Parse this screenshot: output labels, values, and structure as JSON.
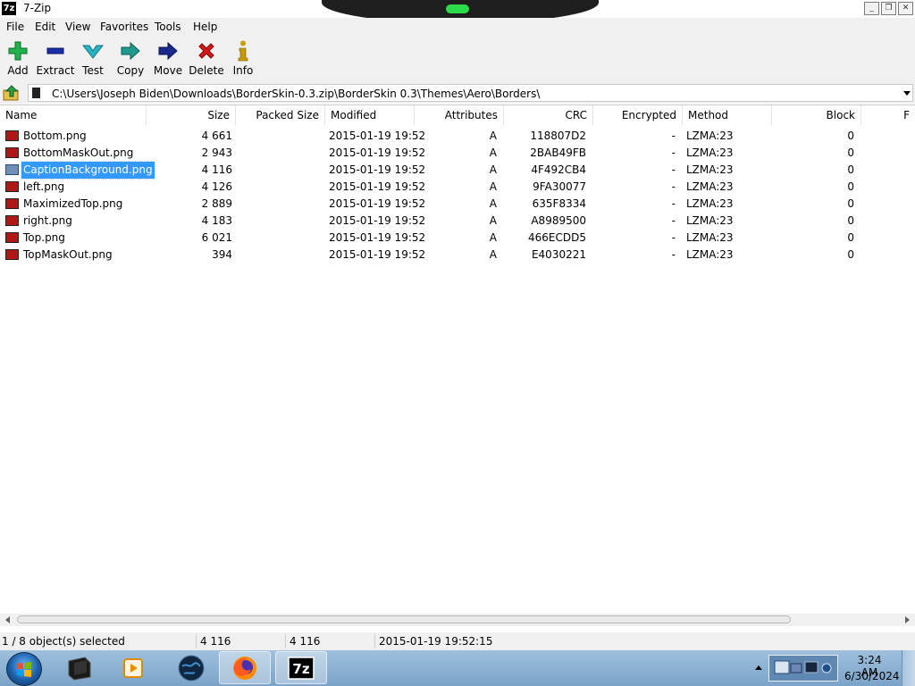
{
  "window": {
    "title": "7-Zip",
    "app_icon": "7z"
  },
  "menu": [
    "File",
    "Edit",
    "View",
    "Favorites",
    "Tools",
    "Help"
  ],
  "toolbar": [
    {
      "label": "Add",
      "icon": "plus-icon",
      "color": "#22b14c"
    },
    {
      "label": "Extract",
      "icon": "minus-icon",
      "color": "#1a2fa8"
    },
    {
      "label": "Test",
      "icon": "check-chevron-icon",
      "color": "#27b6c4"
    },
    {
      "label": "Copy",
      "icon": "arrow-right-icon",
      "color": "#1d9a8c"
    },
    {
      "label": "Move",
      "icon": "arrow-right-icon",
      "color": "#1a2a8c"
    },
    {
      "label": "Delete",
      "icon": "x-icon",
      "color": "#d61818"
    },
    {
      "label": "Info",
      "icon": "info-icon",
      "color": "#c89b00"
    }
  ],
  "address": {
    "path": "C:\\Users\\Joseph Biden\\Downloads\\BorderSkin-0.3.zip\\BorderSkin 0.3\\Themes\\Aero\\Borders\\"
  },
  "columns": [
    "Name",
    "Size",
    "Packed Size",
    "Modified",
    "Attributes",
    "CRC",
    "Encrypted",
    "Method",
    "Block",
    "F"
  ],
  "files": [
    {
      "name": "Bottom.png",
      "size": "4 661",
      "packed": "",
      "modified": "2015-01-19 19:52",
      "attr": "A",
      "crc": "118807D2",
      "enc": "-",
      "method": "LZMA:23",
      "block": "0"
    },
    {
      "name": "BottomMaskOut.png",
      "size": "2 943",
      "packed": "",
      "modified": "2015-01-19 19:52",
      "attr": "A",
      "crc": "2BAB49FB",
      "enc": "-",
      "method": "LZMA:23",
      "block": "0"
    },
    {
      "name": "CaptionBackground.png",
      "size": "4 116",
      "packed": "",
      "modified": "2015-01-19 19:52",
      "attr": "A",
      "crc": "4F492CB4",
      "enc": "-",
      "method": "LZMA:23",
      "block": "0",
      "selected": true
    },
    {
      "name": "left.png",
      "size": "4 126",
      "packed": "",
      "modified": "2015-01-19 19:52",
      "attr": "A",
      "crc": "9FA30077",
      "enc": "-",
      "method": "LZMA:23",
      "block": "0"
    },
    {
      "name": "MaximizedTop.png",
      "size": "2 889",
      "packed": "",
      "modified": "2015-01-19 19:52",
      "attr": "A",
      "crc": "635F8334",
      "enc": "-",
      "method": "LZMA:23",
      "block": "0"
    },
    {
      "name": "right.png",
      "size": "4 183",
      "packed": "",
      "modified": "2015-01-19 19:52",
      "attr": "A",
      "crc": "A8989500",
      "enc": "-",
      "method": "LZMA:23",
      "block": "0"
    },
    {
      "name": "Top.png",
      "size": "6 021",
      "packed": "",
      "modified": "2015-01-19 19:52",
      "attr": "A",
      "crc": "466ECDD5",
      "enc": "-",
      "method": "LZMA:23",
      "block": "0"
    },
    {
      "name": "TopMaskOut.png",
      "size": "394",
      "packed": "",
      "modified": "2015-01-19 19:52",
      "attr": "A",
      "crc": "E4030221",
      "enc": "-",
      "method": "LZMA:23",
      "block": "0"
    }
  ],
  "status": {
    "selection": "1 / 8 object(s) selected",
    "size": "4 116",
    "packed": "4 116",
    "modified": "2015-01-19 19:52:15"
  },
  "taskbar": {
    "apps": [
      "terminal-icon",
      "media-player-icon",
      "globe-icon",
      "firefox-icon",
      "7zip-icon"
    ],
    "active_app": "7zip-icon",
    "tray_label": "tray-icons",
    "time": "3:24 AM",
    "date": "6/30/2024",
    "colors": {
      "taskbar": "#8fb3d6",
      "selection": "#3399ff"
    }
  }
}
